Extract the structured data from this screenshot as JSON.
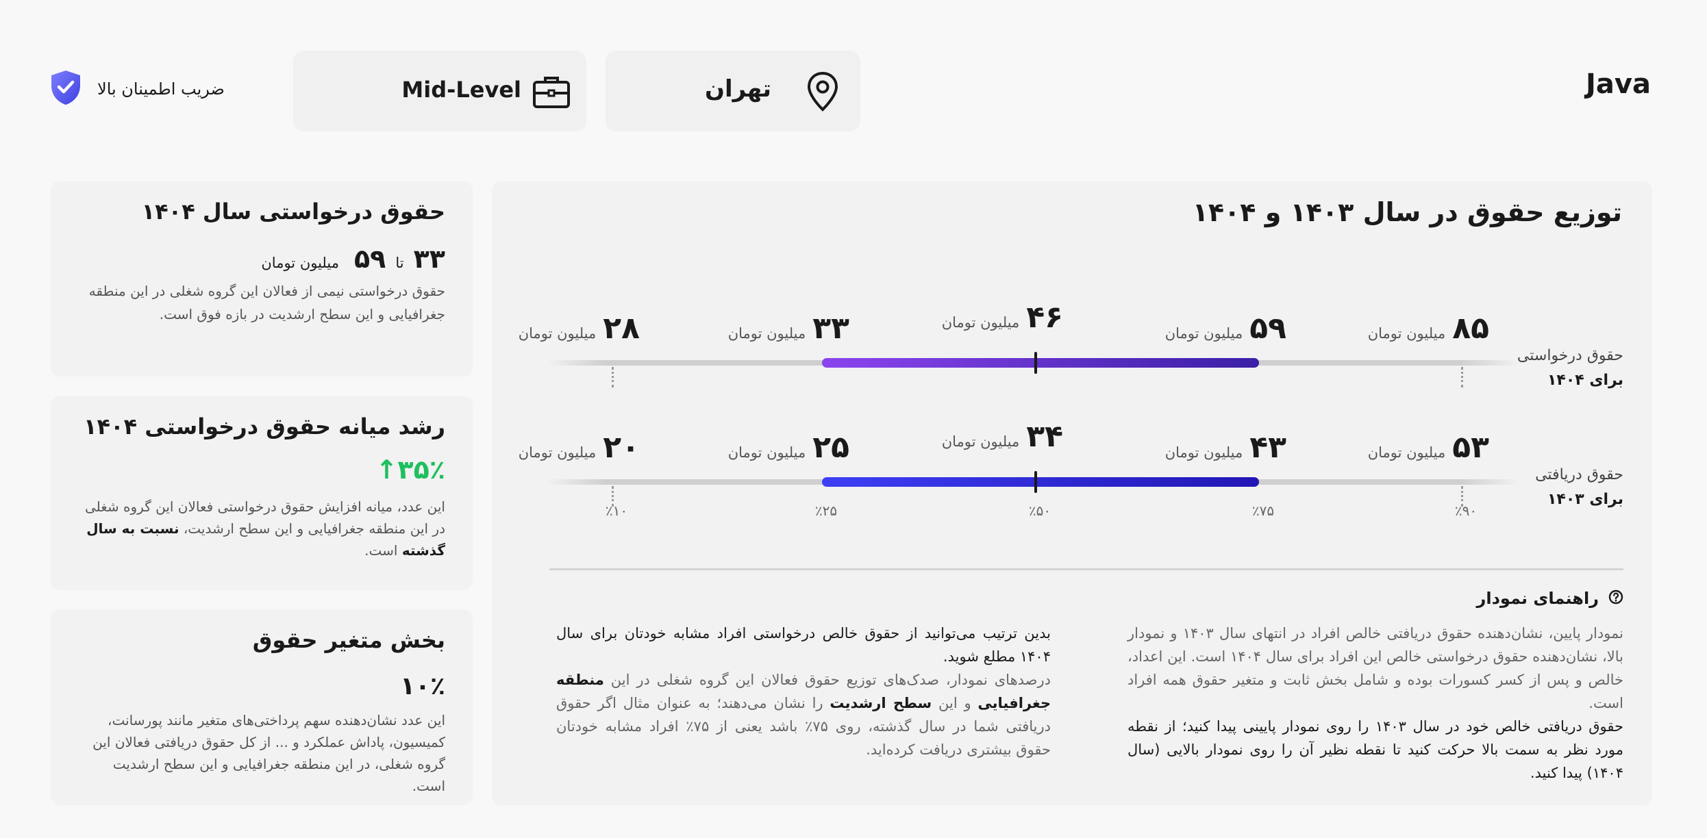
{
  "header": {
    "title": "Java",
    "location": "تهران",
    "level": "Mid-Level",
    "confidence": "ضریب اطمینان بالا"
  },
  "side_cards": {
    "requested": {
      "title": "حقوق درخواستی سال ۱۴۰۴",
      "min": "۳۳",
      "to": "تا",
      "max": "۵۹",
      "unit": "میلیون تومان",
      "desc": "حقوق درخواستی نیمی از فعالان این گروه شغلی در این منطقه جغرافیایی و این سطح ارشدیت در بازه فوق است."
    },
    "growth": {
      "title": "رشد میانه حقوق درخواستی ۱۴۰۴",
      "value": "↑۳۵٪",
      "desc_part1": "این عدد، میانه افزایش حقوق درخواستی فعالان این گروه شغلی در این منطقه جغرافیایی و این سطح ارشدیت، ",
      "desc_bold": "نسبت به سال گذشته",
      "desc_part2": " است."
    },
    "variable": {
      "title": "بخش متغیر حقوق",
      "value": "۱۰٪",
      "desc": "این عدد نشان‌دهنده سهم پرداختی‌های متغیر مانند پورسانت، کمیسیون، پاداش عملکرد و ... از کل حقوق دریافتی فعالان این گروه شغلی، در این منطقه جغرافیایی و این سطح ارشدیت است."
    }
  },
  "main": {
    "title": "توزیع حقوق در سال ۱۴۰۳ و ۱۴۰۴",
    "legend_title": "راهنمای نمودار",
    "legend_col1_gray": "نمودار پایین، نشان‌دهنده حقوق دریافتی خالص افراد در انتهای سال ۱۴۰۳ و نمودار بالا، نشان‌دهنده حقوق درخواستی خالص این افراد برای سال ۱۴۰۴ است. این اعداد، خالص و پس از کسر کسورات بوده و شامل بخش ثابت و متغیر حقوق همه افراد است.",
    "legend_col1_black": "حقوق دریافتی خالص خود در سال ۱۴۰۳ را روی نمودار پایینی پیدا کنید؛ از نقطه مورد نظر به سمت بالا حرکت کنید تا نقطه نظیر آن را روی نمودار بالایی (سال ۱۴۰۴) پیدا کنید.",
    "legend_col2_black": "بدین ترتیب می‌توانید از حقوق خالص درخواستی افراد مشابه خودتان برای سال ۱۴۰۴ مطلع شوید.",
    "legend_col2_p1": "درصدهای نمودار، صدک‌های توزیع حقوق فعالان این گروه شغلی در این ",
    "legend_col2_b1": "منطقه جغرافیایی",
    "legend_col2_p2": " و این ",
    "legend_col2_b2": "سطح ارشدیت",
    "legend_col2_p3": " را نشان می‌دهند؛ به عنوان مثال اگر حقوق دریافتی شما در سال گذشته، روی ۷۵٪ باشد یعنی از ۷۵٪ افراد مشابه خودتان حقوق بیشتری دریافت کرده‌اید."
  },
  "chart_data": {
    "type": "range",
    "unit": "میلیون تومان",
    "percentiles": [
      "٪۱۰",
      "٪۲۵",
      "٪۵۰",
      "٪۷۵",
      "٪۹۰"
    ],
    "series": [
      {
        "name_line1": "حقوق درخواستی",
        "name_line2": "برای ۱۴۰۴",
        "labels": [
          "۲۸",
          "۳۳",
          "۴۶",
          "۵۹",
          "۸۵"
        ],
        "values": [
          28,
          33,
          46,
          59,
          85
        ],
        "color_start": "#8b45ee",
        "color_end": "#3b1fa6"
      },
      {
        "name_line1": "حقوق دریافتی",
        "name_line2": "برای ۱۴۰۳",
        "labels": [
          "۲۰",
          "۲۵",
          "۳۴",
          "۴۳",
          "۵۳"
        ],
        "values": [
          20,
          25,
          34,
          43,
          53
        ],
        "color_start": "#3e3ff5",
        "color_end": "#2216b5"
      }
    ]
  },
  "colors": {
    "accent_green": "#1fbf5f",
    "shield": "#5b5cf0"
  }
}
